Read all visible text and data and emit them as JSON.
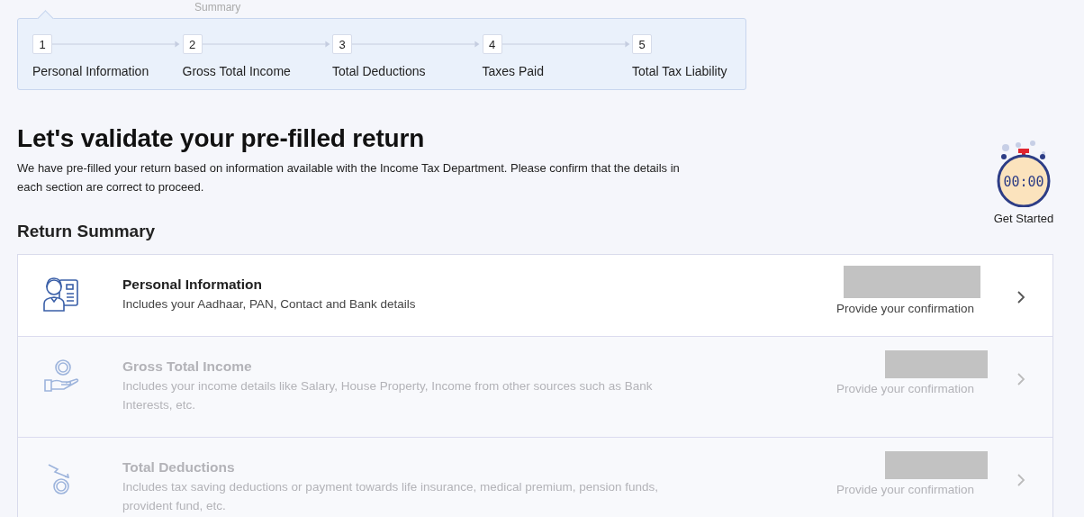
{
  "breadcrumb": {
    "label": "Summary"
  },
  "steps": [
    {
      "number": "1",
      "label": "Personal Information"
    },
    {
      "number": "2",
      "label": "Gross Total Income"
    },
    {
      "number": "3",
      "label": "Total Deductions"
    },
    {
      "number": "4",
      "label": "Taxes Paid"
    },
    {
      "number": "5",
      "label": "Total Tax Liability"
    }
  ],
  "heading": "Let's validate your pre-filled return",
  "intro": "We have pre-filled your return based on information available with the Income Tax Department. Please confirm that the details in each section are correct to proceed.",
  "timer": {
    "display": "00:00",
    "label": "Get Started"
  },
  "section_title": "Return Summary",
  "sections": [
    {
      "kind": "person",
      "title": "Personal Information",
      "description": "Includes your Aadhaar, PAN, Contact and Bank details",
      "status": "Provide your confirmation",
      "redacted": true,
      "disabled": false
    },
    {
      "kind": "income",
      "title": "Gross Total Income",
      "description": "Includes your income details like Salary, House Property, Income from other sources such as Bank Interests, etc.",
      "status": "Provide your confirmation",
      "redacted": true,
      "disabled": true
    },
    {
      "kind": "deduction",
      "title": "Total Deductions",
      "description": "Includes tax saving deductions or payment towards life insurance, medical premium, pension funds, provident fund, etc.",
      "status": "Provide your confirmation",
      "redacted": true,
      "disabled": true
    }
  ]
}
